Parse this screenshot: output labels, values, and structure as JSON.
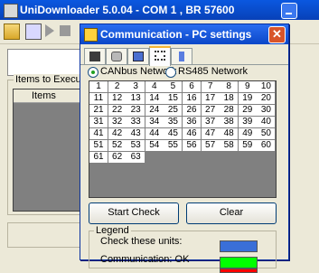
{
  "main_window": {
    "title": "UniDownloader 5.0.04 - COM 1 , BR 57600",
    "items_group_label": "Items to Execute",
    "items_column_header": "Items"
  },
  "dialog": {
    "title": "Communication - PC settings",
    "tabs": [
      "calculator-icon",
      "settings-icon",
      "network-icon",
      "connection-icon",
      "usb-icon"
    ],
    "network": {
      "canbus_label": "CANbus Network",
      "rs485_label": "RS485 Network",
      "selected": "CANbus Network"
    },
    "units": [
      "1",
      "2",
      "3",
      "4",
      "5",
      "6",
      "7",
      "8",
      "9",
      "10",
      "11",
      "12",
      "13",
      "14",
      "15",
      "16",
      "17",
      "18",
      "19",
      "20",
      "21",
      "22",
      "23",
      "24",
      "25",
      "26",
      "27",
      "28",
      "29",
      "30",
      "31",
      "32",
      "33",
      "34",
      "35",
      "36",
      "37",
      "38",
      "39",
      "40",
      "41",
      "42",
      "43",
      "44",
      "45",
      "46",
      "47",
      "48",
      "49",
      "50",
      "51",
      "52",
      "53",
      "54",
      "55",
      "56",
      "57",
      "58",
      "59",
      "60",
      "61",
      "62",
      "63"
    ],
    "start_check_label": "Start Check",
    "clear_label": "Clear",
    "legend": {
      "title": "Legend",
      "check_label": "Check these units:",
      "check_color": "#3a6fd8",
      "ok_label": "Communication: OK",
      "ok_color": "#00ff00",
      "third_color": "#ff0000"
    }
  }
}
